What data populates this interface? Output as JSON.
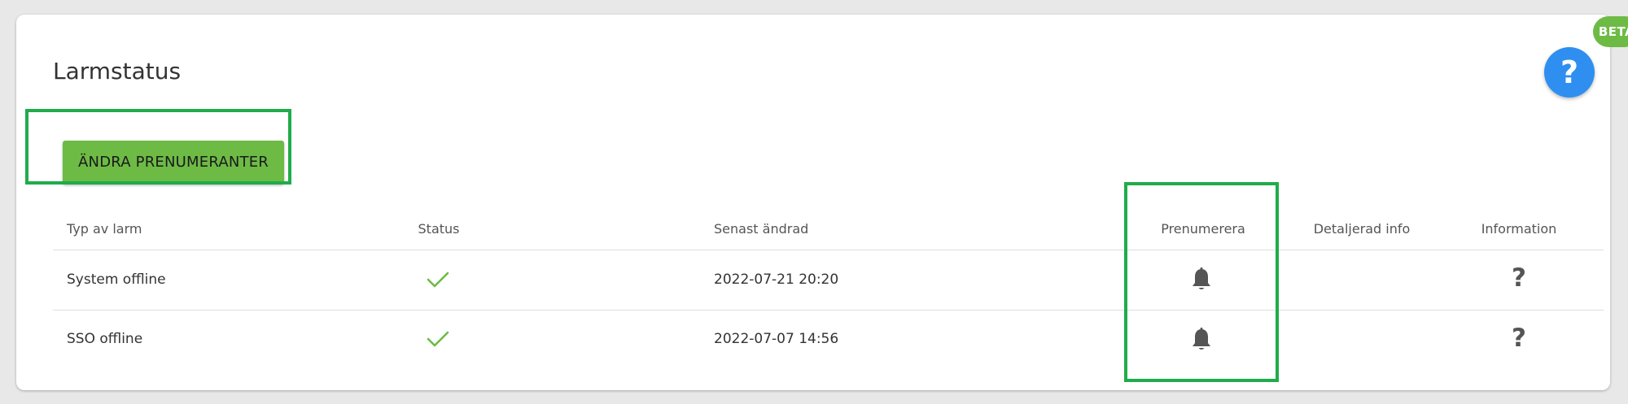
{
  "card": {
    "title": "Larmstatus",
    "badge": "BETA",
    "help_icon_glyph": "?"
  },
  "actions": {
    "change_subscribers_label": "ÄNDRA PRENUMERANTER"
  },
  "table": {
    "headers": {
      "type": "Typ av larm",
      "status": "Status",
      "last_changed": "Senast ändrad",
      "subscribe": "Prenumerera",
      "detailed_info": "Detaljerad info",
      "information": "Information"
    },
    "rows": [
      {
        "type": "System offline",
        "status_icon": "check-icon",
        "last_changed": "2022-07-21 20:20",
        "subscribe_icon": "bell-icon",
        "detailed_info": "",
        "information_glyph": "?"
      },
      {
        "type": "SSO offline",
        "status_icon": "check-icon",
        "last_changed": "2022-07-07 14:56",
        "subscribe_icon": "bell-icon",
        "detailed_info": "",
        "information_glyph": "?"
      }
    ]
  },
  "colors": {
    "accent_green": "#6dbb45",
    "highlight_green": "#1fac4a",
    "help_blue": "#2f8ff0",
    "check_green": "#6dbb45",
    "icon_gray": "#555555"
  }
}
